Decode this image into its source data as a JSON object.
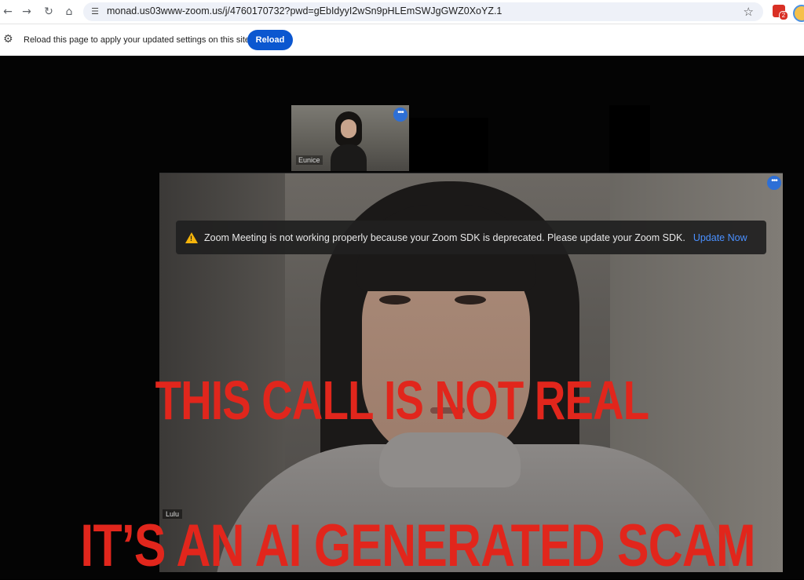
{
  "browser": {
    "url": "monad.us03www-zoom.us/j/4760170732?pwd=gEbIdyyI2wSn9pHLEmSWJgGWZ0XoYZ.1",
    "extension_badge": "2",
    "icons": [
      "back-icon",
      "forward-icon",
      "refresh-icon",
      "home-icon",
      "tune-icon",
      "star-icon"
    ]
  },
  "infobar": {
    "message": "Reload this page to apply your updated settings on this site",
    "button_label": "Reload"
  },
  "meeting": {
    "participants": [
      {
        "name": "Eunice"
      },
      {
        "name": "Lulu"
      }
    ],
    "more_button": "•••",
    "banner": {
      "message": "Zoom Meeting is not working properly because your Zoom SDK is deprecated. Please update your Zoom SDK.",
      "action": "Update Now",
      "warning_glyph": "!"
    }
  },
  "overlay": {
    "line1": "THIS CALL IS NOT REAL",
    "line2": "IT’S AN AI GENERATED SCAM",
    "color": "#e1261c"
  }
}
